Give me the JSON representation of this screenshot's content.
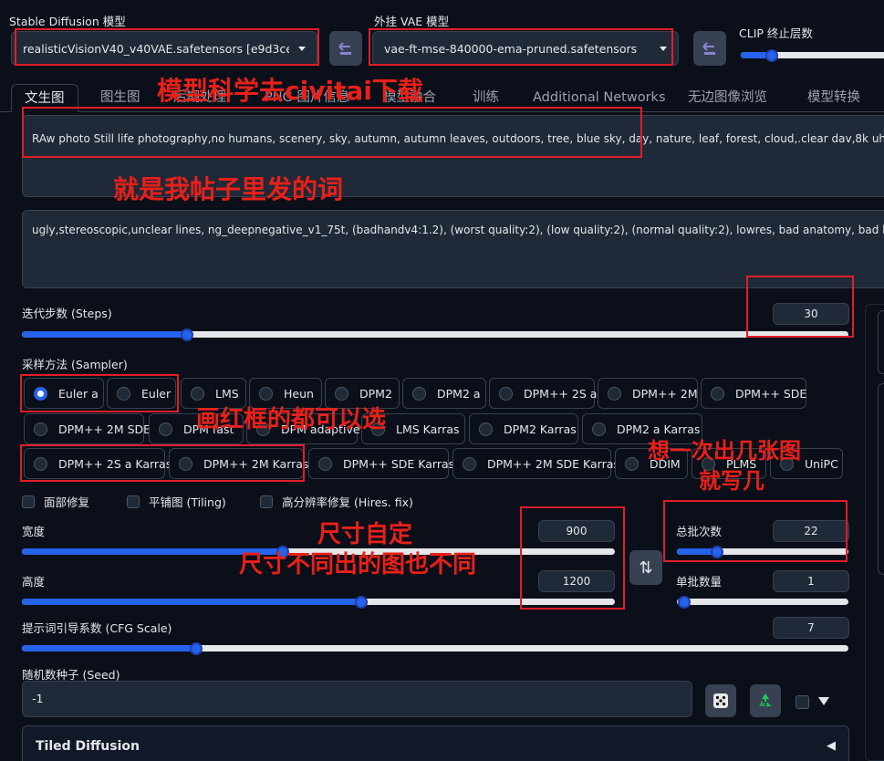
{
  "top": {
    "model_label": "Stable Diffusion 模型",
    "model_value": "realisticVisionV40_v40VAE.safetensors [e9d3ced",
    "vae_label": "外挂 VAE 模型",
    "vae_value": "vae-ft-mse-840000-ema-pruned.safetensors",
    "clip_label": "CLIP 终止层数"
  },
  "tabs": [
    "文生图",
    "图生图",
    "后期处理",
    "PNG 图片信息",
    "模型融合",
    "训练",
    "Additional Networks",
    "无边图像浏览",
    "模型转换"
  ],
  "prompt": "RAw photo Still life photography,no humans, scenery, sky, autumn, autumn leaves, outdoors, tree, blue sky, day, nature, leaf, forest, cloud,.clear dav,8k uhd.high q",
  "negative_prompt": "ugly,stereoscopic,unclear lines, ng_deepnegative_v1_75t, (badhandv4:1.2), (worst quality:2), (low quality:2), (normal quality:2), lowres, bad anatomy, bad hands,",
  "steps": {
    "label": "迭代步数 (Steps)",
    "value": "30",
    "level": 0.2
  },
  "sampler": {
    "label": "采样方法 (Sampler)",
    "options": [
      "Euler a",
      "Euler",
      "LMS",
      "Heun",
      "DPM2",
      "DPM2 a",
      "DPM++ 2S a",
      "DPM++ 2M",
      "DPM++ SDE",
      "DPM++ 2M SDE",
      "DPM fast",
      "DPM adaptive",
      "LMS Karras",
      "DPM2 Karras",
      "DPM2 a Karras",
      "DPM++ 2S a Karras",
      "DPM++ 2M Karras",
      "DPM++ SDE Karras",
      "DPM++ 2M SDE Karras",
      "DDIM",
      "PLMS",
      "UniPC"
    ],
    "selected": "Euler a"
  },
  "checks": {
    "face": "面部修复",
    "tiling": "平铺图 (Tiling)",
    "hires": "高分辨率修复 (Hires. fix)"
  },
  "width": {
    "label": "宽度",
    "value": "900",
    "level": 0.44
  },
  "height": {
    "label": "高度",
    "value": "1200",
    "level": 0.59
  },
  "swap_icon": "⇅",
  "batch_count": {
    "label": "总批次数",
    "value": "22",
    "level": 0.22
  },
  "batch_size": {
    "label": "单批数量",
    "value": "1",
    "level": 0.0
  },
  "cfg": {
    "label": "提示词引导系数 (CFG Scale)",
    "value": "7",
    "level": 0.21
  },
  "seed": {
    "label": "随机数种子 (Seed)",
    "value": "-1"
  },
  "tiled": {
    "label": "Tiled Diffusion",
    "arrow": "◀"
  },
  "annotations": {
    "model": "模型科学去civitai下载",
    "prompt": "就是我帖子里发的词",
    "sampler": "画红框的都可以选",
    "batch1": "想一次出几张图",
    "batch2": "就写几",
    "size1": "尺寸自定",
    "size2": "尺寸不同出的图也不同"
  },
  "colors": {
    "accent": "#2563eb",
    "annotation": "#e8201a",
    "background": "#0b0f19"
  }
}
